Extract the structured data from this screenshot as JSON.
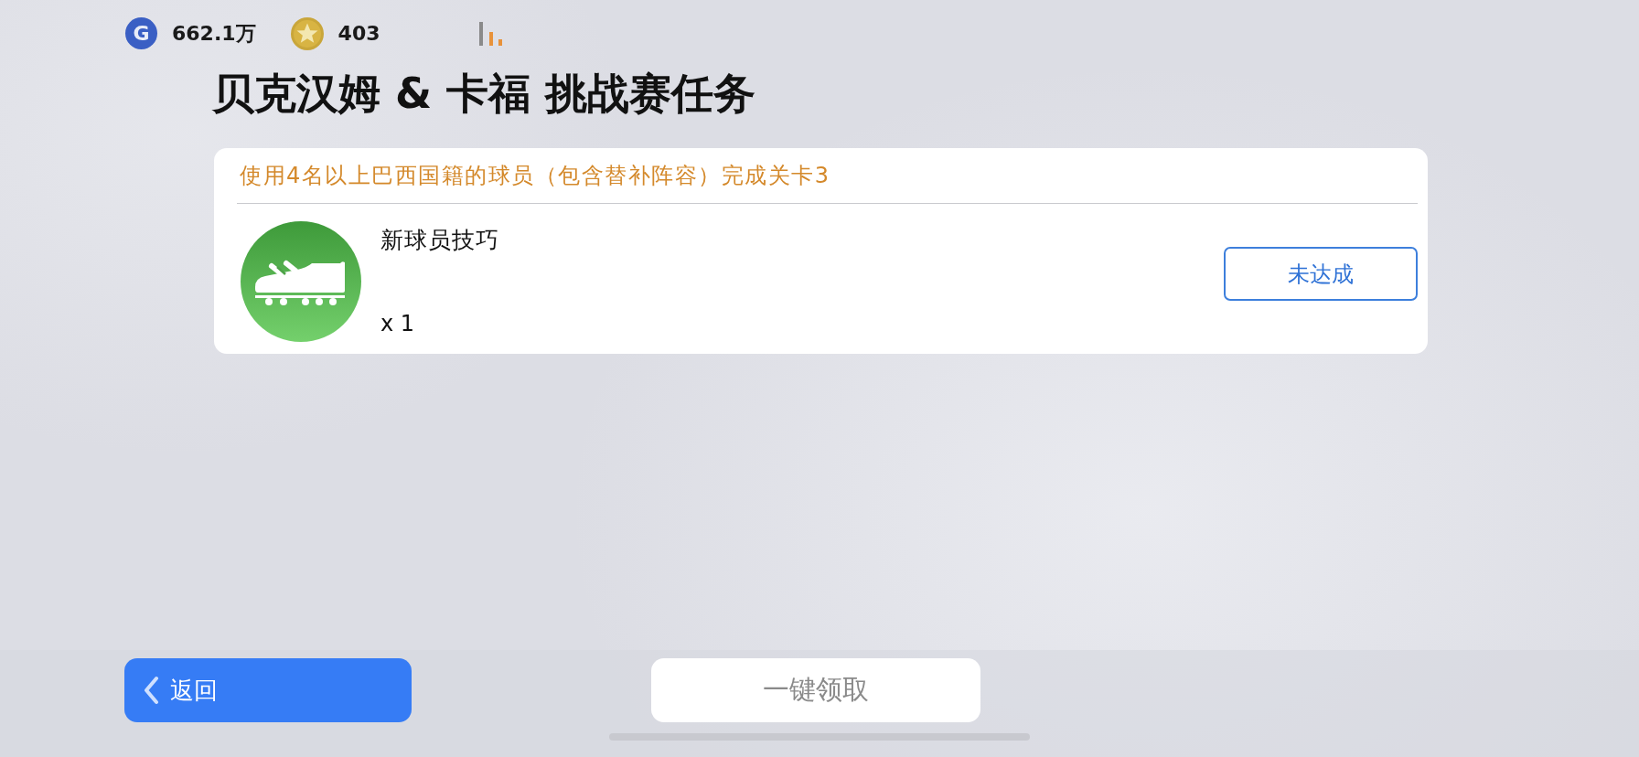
{
  "currencies": [
    {
      "kind": "gp",
      "symbol": "G",
      "amount": "662.1万"
    },
    {
      "kind": "coin",
      "amount": "403"
    }
  ],
  "title": "贝克汉姆 & 卡福 挑战赛任务",
  "missions": [
    {
      "condition": "使用4名以上巴西国籍的球员（包含替补阵容）完成关卡3",
      "reward": {
        "kind": "skill",
        "name": "新球员技巧",
        "quantity": "x 1"
      },
      "status": {
        "label": "未达成",
        "completed": false
      }
    }
  ],
  "footer": {
    "back_button": {
      "label": "返回"
    },
    "claim_all_button": {
      "label": "一键领取",
      "disabled": true
    }
  }
}
